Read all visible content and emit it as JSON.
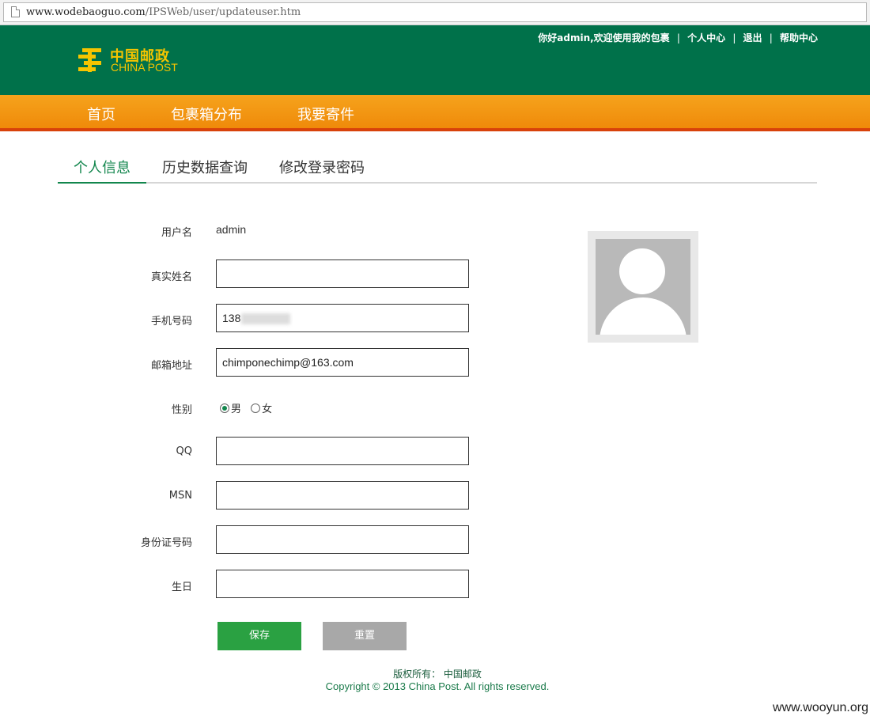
{
  "browser": {
    "url_domain": "www.wodebaoguo.com",
    "url_path": "/IPSWeb/user/updateuser.htm"
  },
  "header": {
    "logo_cn": "中国邮政",
    "logo_en": "CHINA POST",
    "greeting": "你好admin,欢迎使用我的包裹",
    "links": [
      "个人中心",
      "退出",
      "帮助中心"
    ],
    "separator": "|"
  },
  "nav": {
    "items": [
      "首页",
      "包裹箱分布",
      "我要寄件"
    ]
  },
  "tabs": {
    "items": [
      "个人信息",
      "历史数据查询",
      "修改登录密码"
    ],
    "active_index": 0
  },
  "form": {
    "username_label": "用户名",
    "username_value": "admin",
    "realname_label": "真实姓名",
    "realname_value": "",
    "phone_label": "手机号码",
    "phone_value": "138",
    "email_label": "邮箱地址",
    "email_value": "chimponechimp@163.com",
    "gender_label": "性别",
    "gender_options": [
      "男",
      "女"
    ],
    "gender_selected": "男",
    "qq_label": "QQ",
    "qq_value": "",
    "msn_label": "MSN",
    "msn_value": "",
    "idcard_label": "身份证号码",
    "idcard_value": "",
    "birthday_label": "生日",
    "birthday_value": "",
    "save_label": "保存",
    "reset_label": "重置"
  },
  "footer": {
    "copyright_cn": "版权所有：  中国邮政",
    "copyright_en": "Copyright © 2013 China Post. All rights reserved."
  },
  "watermark": "www.wooyun.org",
  "colors": {
    "header_green": "#00714a",
    "nav_orange": "#f39a12",
    "nav_border": "#d8420a",
    "accent_green": "#12864d",
    "save_button": "#2aa142",
    "reset_button": "#a8a8a8",
    "logo_yellow": "#f5c400"
  }
}
